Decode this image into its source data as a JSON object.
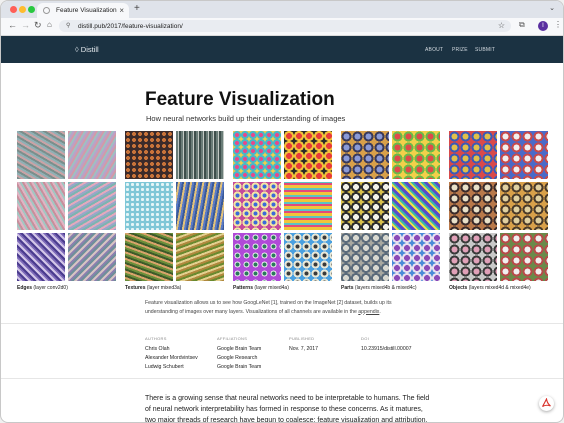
{
  "browser": {
    "tab_title": "Feature Visualization",
    "url": "distill.pub/2017/feature-visualization/",
    "profile_initial": "I"
  },
  "site": {
    "logo_text": "Distill",
    "nav": [
      "ABOUT",
      "PRIZE",
      "SUBMIT"
    ]
  },
  "article": {
    "title": "Feature Visualization",
    "subtitle": "How neural networks build up their understanding of images",
    "groups": [
      {
        "name": "Edges",
        "detail": " (layer conv2d0)"
      },
      {
        "name": "Textures",
        "detail": " (layer mixed3a)"
      },
      {
        "name": "Patterns",
        "detail": " (layer mixed4a)"
      },
      {
        "name": "Parts",
        "detail": " (layers mixed4b & mixed4c)"
      },
      {
        "name": "Objects",
        "detail": " (layers mixed4d & mixed4e)"
      }
    ],
    "caption_pre": "Feature visualization allows us to see how GoogLeNet [1], trained on the ImageNet [2] dataset, builds up its understanding of images over many layers. Visualizations of all channels are available in the ",
    "caption_link": "appendix",
    "caption_post": ".",
    "meta": {
      "authors_label": "AUTHORS",
      "authors": [
        "Chris Olah",
        "Alexander Mordvintsev",
        "Ludwig Schubert"
      ],
      "affiliations_label": "AFFILIATIONS",
      "affiliations": [
        "Google Brain Team",
        "Google Research",
        "Google Brain Team"
      ],
      "published_label": "PUBLISHED",
      "published": "Nov. 7, 2017",
      "doi_label": "DOI",
      "doi": "10.23915/distill.00007"
    },
    "body": "There is a growing sense that neural networks need to be interpretable to humans. The field of neural network interpretability has formed in response to these concerns. As it matures, two major threads of research have begun to coalesce: feature visualization and attribution."
  },
  "colors": {
    "header_bg": "#1b3242",
    "tab_strip": "#dfe3ea",
    "close_dot": "#ff5f57",
    "min_dot": "#febc2e",
    "zoom_dot": "#28c840",
    "pdf_red": "#d9322b"
  }
}
